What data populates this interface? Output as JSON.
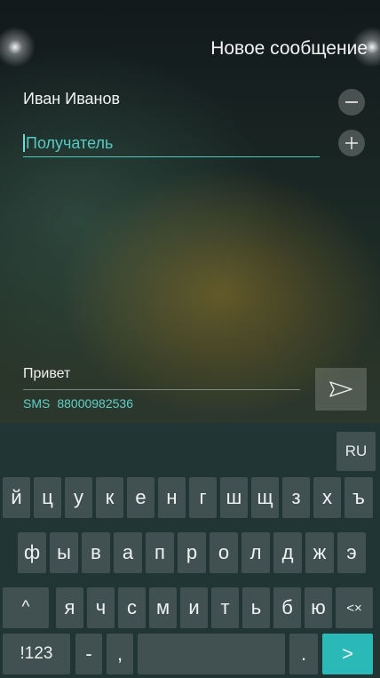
{
  "header": {
    "title": "Новое сообщение"
  },
  "recipients": {
    "chip_name": "Иван Иванов",
    "input_placeholder": "Получатель",
    "remove_icon": "minus-circle-icon",
    "add_icon": "plus-circle-icon"
  },
  "compose": {
    "message_text": "Привет",
    "channel": "SMS",
    "number": "88000982536",
    "send_icon": "send-arrow-icon"
  },
  "keyboard": {
    "language": "RU",
    "row1": [
      "й",
      "ц",
      "у",
      "к",
      "е",
      "н",
      "г",
      "ш",
      "щ",
      "з",
      "х",
      "ъ"
    ],
    "row2": [
      "ф",
      "ы",
      "в",
      "а",
      "п",
      "р",
      "о",
      "л",
      "д",
      "ж",
      "э"
    ],
    "row3": [
      "^",
      "я",
      "ч",
      "с",
      "м",
      "и",
      "т",
      "ь",
      "б",
      "ю",
      "<×"
    ],
    "row4": {
      "numbers": "!123",
      "dash": "-",
      "comma": ",",
      "space": "",
      "period": ".",
      "go": ">"
    },
    "accent": "#2bb9b8"
  }
}
